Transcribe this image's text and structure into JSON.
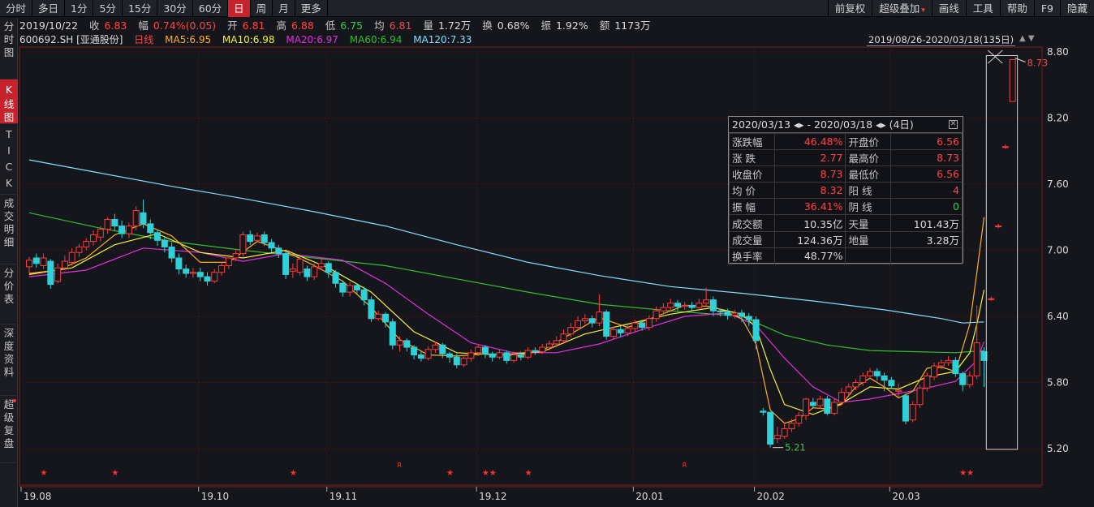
{
  "top_bar": {
    "period_tabs": [
      "分时",
      "多日",
      "1分",
      "5分",
      "15分",
      "30分",
      "60分",
      "日",
      "周",
      "月",
      "更多"
    ],
    "active_period": "日",
    "tool_tabs": [
      "前复权",
      "超级叠加",
      "画线",
      "工具",
      "帮助",
      "F9",
      "隐藏"
    ]
  },
  "side_tabs": [
    {
      "label": "分时图",
      "active": false
    },
    {
      "label": "K线图",
      "active": true
    },
    {
      "label": "TICK",
      "active": false
    },
    {
      "label": "成交明细",
      "active": false
    },
    {
      "label": "分价表",
      "active": false
    },
    {
      "label": "深度资料",
      "active": false
    },
    {
      "label": "超级复盘",
      "active": false,
      "dot": true
    }
  ],
  "quote": {
    "date": "2019/10/22",
    "close_label": "收",
    "close": "6.83",
    "change_label": "幅",
    "change": "0.74%(0.05)",
    "open_label": "开",
    "open": "6.81",
    "high_label": "高",
    "high": "6.88",
    "low_label": "低",
    "low": "6.75",
    "avg_label": "均",
    "avg": "6.81",
    "volume_label": "量",
    "volume": "1.72万",
    "turnover_label": "换",
    "turnover": "0.68%",
    "amplitude_label": "振",
    "amplitude": "1.92%",
    "amount_label": "额",
    "amount": "1173万"
  },
  "legend": {
    "code": "600692.SH [亚通股份]",
    "kline": "日线",
    "ma5": "MA5:6.95",
    "ma10": "MA10:6.98",
    "ma20": "MA20:6.97",
    "ma60": "MA60:6.94",
    "ma120": "MA120:7.33"
  },
  "range_label": "2019/08/26-2020/03/18(135日)",
  "colors": {
    "up": "#ff3b3b",
    "down": "#2fd1d8",
    "ma5": "#ffb020",
    "ma10": "#f5f23a",
    "ma20": "#e030e0",
    "ma60": "#2fbf2f",
    "ma120": "#7fe0ff",
    "grid": "#5a1a1a",
    "background": "#15161b"
  },
  "info_box": {
    "date_range": "2020/03/13 ◂▸ - 2020/03/18 ◂▸ (4日)",
    "rows": [
      {
        "k1": "涨跌幅",
        "v1": "46.48%",
        "c1": "red",
        "k2": "开盘价",
        "v2": "6.56",
        "c2": "red"
      },
      {
        "k1": "涨  跌",
        "v1": "2.77",
        "c1": "red",
        "k2": "最高价",
        "v2": "8.73",
        "c2": "red"
      },
      {
        "k1": "收盘价",
        "v1": "8.73",
        "c1": "red",
        "k2": "最低价",
        "v2": "6.56",
        "c2": "red"
      },
      {
        "k1": "均  价",
        "v1": "8.32",
        "c1": "red",
        "k2": "阳  线",
        "v2": "4",
        "c2": "red"
      },
      {
        "k1": "振  幅",
        "v1": "36.41%",
        "c1": "red",
        "k2": "阴  线",
        "v2": "0",
        "c2": "green"
      },
      {
        "k1": "成交额",
        "v1": "10.35亿",
        "c1": "white",
        "k2": "天量",
        "v2": "101.43万",
        "c2": "white"
      },
      {
        "k1": "成交量",
        "v1": "124.36万",
        "c1": "white",
        "k2": "地量",
        "v2": "3.28万",
        "c2": "white"
      },
      {
        "k1": "换手率",
        "v1": "48.77%",
        "c1": "white",
        "k2": "",
        "v2": "",
        "c2": "white"
      }
    ]
  },
  "chart_data": {
    "type": "candlestick",
    "y_ticks": [
      "8.80",
      "8.20",
      "7.60",
      "7.00",
      "6.40",
      "5.80",
      "5.20"
    ],
    "ylim": [
      5.15,
      8.85
    ],
    "x_ticks": [
      {
        "label": "19.08",
        "index": 0
      },
      {
        "label": "19.10",
        "index": 24
      },
      {
        "label": "19.11",
        "index": 42
      },
      {
        "label": "19.12",
        "index": 63
      },
      {
        "label": "20.01",
        "index": 85
      },
      {
        "label": "20.02",
        "index": 102
      },
      {
        "label": "20.03",
        "index": 121
      }
    ],
    "annotations": {
      "high_label": "8.73",
      "low_label": "5.21",
      "marker_star": "★",
      "marker_r": "R",
      "star_indices": [
        2,
        12,
        37,
        59,
        64,
        65,
        70,
        131,
        132
      ],
      "r_indices": [
        52,
        92
      ]
    },
    "candles": [
      [
        6.85,
        6.91,
        6.94,
        6.79
      ],
      [
        6.93,
        6.88,
        6.97,
        6.84
      ],
      [
        6.86,
        6.93,
        6.97,
        6.83
      ],
      [
        6.9,
        6.69,
        6.92,
        6.65
      ],
      [
        6.72,
        6.84,
        6.88,
        6.7
      ],
      [
        6.84,
        6.9,
        6.95,
        6.82
      ],
      [
        6.89,
        6.98,
        7.02,
        6.86
      ],
      [
        6.98,
        7.03,
        7.06,
        6.94
      ],
      [
        7.03,
        7.08,
        7.11,
        7.0
      ],
      [
        7.08,
        7.14,
        7.18,
        7.04
      ],
      [
        7.12,
        7.19,
        7.22,
        7.08
      ],
      [
        7.19,
        7.28,
        7.3,
        7.15
      ],
      [
        7.28,
        7.22,
        7.33,
        7.18
      ],
      [
        7.22,
        7.15,
        7.27,
        7.11
      ],
      [
        7.15,
        7.22,
        7.25,
        7.11
      ],
      [
        7.22,
        7.36,
        7.4,
        7.18
      ],
      [
        7.34,
        7.24,
        7.46,
        7.2
      ],
      [
        7.24,
        7.16,
        7.28,
        7.1
      ],
      [
        7.16,
        7.09,
        7.19,
        7.04
      ],
      [
        7.09,
        7.03,
        7.12,
        6.98
      ],
      [
        7.03,
        6.93,
        7.07,
        6.89
      ],
      [
        6.93,
        6.83,
        6.97,
        6.78
      ],
      [
        6.83,
        6.79,
        6.87,
        6.75
      ],
      [
        6.79,
        6.8,
        6.84,
        6.75
      ],
      [
        6.8,
        6.76,
        6.84,
        6.72
      ],
      [
        6.76,
        6.72,
        6.8,
        6.68
      ],
      [
        6.72,
        6.8,
        6.83,
        6.7
      ],
      [
        6.8,
        6.86,
        6.89,
        6.77
      ],
      [
        6.86,
        6.93,
        6.96,
        6.83
      ],
      [
        6.93,
        6.97,
        7.0,
        6.9
      ],
      [
        6.97,
        7.14,
        7.17,
        6.94
      ],
      [
        7.14,
        7.08,
        7.18,
        7.05
      ],
      [
        7.09,
        7.13,
        7.16,
        7.07
      ],
      [
        7.14,
        7.07,
        7.17,
        7.04
      ],
      [
        7.07,
        7.02,
        7.1,
        6.98
      ],
      [
        7.02,
        6.97,
        7.05,
        6.93
      ],
      [
        6.97,
        6.78,
        7.0,
        6.74
      ],
      [
        6.81,
        6.83,
        6.88,
        6.75
      ],
      [
        6.8,
        6.92,
        6.95,
        6.77
      ],
      [
        6.83,
        6.76,
        6.86,
        6.72
      ],
      [
        6.76,
        6.85,
        6.88,
        6.73
      ],
      [
        6.85,
        6.88,
        6.93,
        6.82
      ],
      [
        6.88,
        6.8,
        6.9,
        6.75
      ],
      [
        6.8,
        6.7,
        6.82,
        6.66
      ],
      [
        6.7,
        6.62,
        6.72,
        6.58
      ],
      [
        6.62,
        6.68,
        6.71,
        6.58
      ],
      [
        6.68,
        6.64,
        6.7,
        6.6
      ],
      [
        6.64,
        6.55,
        6.67,
        6.5
      ],
      [
        6.55,
        6.38,
        6.58,
        6.35
      ],
      [
        6.38,
        6.42,
        6.45,
        6.36
      ],
      [
        6.42,
        6.35,
        6.44,
        6.3
      ],
      [
        6.35,
        6.14,
        6.38,
        6.1
      ],
      [
        6.14,
        6.18,
        6.22,
        6.08
      ],
      [
        6.18,
        6.12,
        6.2,
        6.08
      ],
      [
        6.12,
        6.05,
        6.14,
        6.01
      ],
      [
        6.05,
        6.02,
        6.08,
        5.99
      ],
      [
        6.02,
        6.1,
        6.13,
        6.0
      ],
      [
        6.1,
        6.14,
        6.17,
        6.07
      ],
      [
        6.14,
        6.06,
        6.16,
        6.02
      ],
      [
        6.06,
        6.03,
        6.08,
        5.98
      ],
      [
        6.03,
        5.96,
        6.06,
        5.93
      ],
      [
        5.96,
        6.02,
        6.05,
        5.94
      ],
      [
        6.02,
        6.07,
        6.1,
        5.99
      ],
      [
        6.07,
        6.12,
        6.15,
        6.04
      ],
      [
        6.12,
        6.06,
        6.14,
        6.02
      ],
      [
        6.06,
        6.03,
        6.08,
        5.99
      ],
      [
        6.03,
        6.07,
        6.1,
        6.01
      ],
      [
        6.07,
        6.0,
        6.09,
        5.97
      ],
      [
        6.0,
        6.05,
        6.08,
        5.98
      ],
      [
        6.05,
        6.03,
        6.08,
        6.0
      ],
      [
        6.03,
        6.09,
        6.12,
        6.01
      ],
      [
        6.09,
        6.08,
        6.12,
        6.05
      ],
      [
        6.08,
        6.12,
        6.15,
        6.06
      ],
      [
        6.12,
        6.15,
        6.18,
        6.09
      ],
      [
        6.15,
        6.18,
        6.22,
        6.12
      ],
      [
        6.18,
        6.24,
        6.28,
        6.15
      ],
      [
        6.24,
        6.3,
        6.34,
        6.21
      ],
      [
        6.3,
        6.36,
        6.4,
        6.27
      ],
      [
        6.36,
        6.38,
        6.42,
        6.33
      ],
      [
        6.38,
        6.34,
        6.41,
        6.3
      ],
      [
        6.34,
        6.44,
        6.6,
        6.31
      ],
      [
        6.44,
        6.22,
        6.46,
        6.19
      ],
      [
        6.22,
        6.28,
        6.31,
        6.19
      ],
      [
        6.28,
        6.25,
        6.31,
        6.21
      ],
      [
        6.25,
        6.29,
        6.32,
        6.22
      ],
      [
        6.29,
        6.34,
        6.37,
        6.26
      ],
      [
        6.34,
        6.3,
        6.37,
        6.27
      ],
      [
        6.3,
        6.38,
        6.41,
        6.27
      ],
      [
        6.38,
        6.45,
        6.49,
        6.35
      ],
      [
        6.45,
        6.48,
        6.52,
        6.42
      ],
      [
        6.48,
        6.52,
        6.56,
        6.45
      ],
      [
        6.52,
        6.49,
        6.55,
        6.45
      ],
      [
        6.49,
        6.5,
        6.53,
        6.46
      ],
      [
        6.5,
        6.48,
        6.53,
        6.45
      ],
      [
        6.48,
        6.52,
        6.56,
        6.45
      ],
      [
        6.52,
        6.55,
        6.66,
        6.49
      ],
      [
        6.55,
        6.45,
        6.58,
        6.4
      ],
      [
        6.45,
        6.44,
        6.47,
        6.4
      ],
      [
        6.44,
        6.41,
        6.47,
        6.37
      ],
      [
        6.41,
        6.43,
        6.46,
        6.38
      ],
      [
        6.43,
        6.4,
        6.46,
        6.35
      ],
      [
        6.4,
        6.37,
        6.43,
        6.31
      ],
      [
        6.37,
        6.18,
        6.4,
        6.1
      ],
      [
        5.54,
        5.53,
        5.57,
        5.5
      ],
      [
        5.53,
        5.24,
        5.53,
        5.21
      ],
      [
        5.29,
        5.32,
        5.4,
        5.25
      ],
      [
        5.31,
        5.38,
        5.43,
        5.29
      ],
      [
        5.38,
        5.43,
        5.47,
        5.35
      ],
      [
        5.43,
        5.5,
        5.53,
        5.4
      ],
      [
        5.5,
        5.65,
        5.66,
        5.46
      ],
      [
        5.62,
        5.59,
        5.66,
        5.56
      ],
      [
        5.59,
        5.65,
        5.68,
        5.56
      ],
      [
        5.65,
        5.52,
        5.68,
        5.5
      ],
      [
        5.52,
        5.62,
        5.65,
        5.5
      ],
      [
        5.62,
        5.71,
        5.75,
        5.6
      ],
      [
        5.71,
        5.76,
        5.79,
        5.68
      ],
      [
        5.76,
        5.8,
        5.83,
        5.73
      ],
      [
        5.8,
        5.86,
        5.89,
        5.77
      ],
      [
        5.86,
        5.9,
        5.93,
        5.83
      ],
      [
        5.9,
        5.86,
        5.93,
        5.82
      ],
      [
        5.86,
        5.82,
        5.89,
        5.72
      ],
      [
        5.82,
        5.77,
        5.85,
        5.74
      ],
      [
        5.72,
        5.73,
        5.79,
        5.66
      ],
      [
        5.68,
        5.45,
        5.7,
        5.42
      ],
      [
        5.46,
        5.6,
        5.63,
        5.44
      ],
      [
        5.6,
        5.75,
        5.78,
        5.57
      ],
      [
        5.75,
        5.86,
        5.89,
        5.72
      ],
      [
        5.85,
        5.95,
        5.98,
        5.82
      ],
      [
        5.95,
        5.98,
        6.01,
        5.92
      ],
      [
        5.98,
        6.0,
        6.04,
        5.95
      ],
      [
        6.0,
        5.88,
        6.03,
        5.85
      ],
      [
        5.88,
        5.78,
        5.9,
        5.72
      ],
      [
        5.78,
        5.86,
        5.9,
        5.75
      ],
      [
        5.86,
        6.16,
        6.5,
        5.83
      ],
      [
        6.08,
        6.0,
        6.12,
        5.76
      ],
      [
        6.56,
        6.56,
        6.58,
        6.54
      ],
      [
        7.22,
        7.22,
        7.24,
        7.2
      ],
      [
        7.94,
        7.94,
        7.96,
        7.92
      ],
      [
        8.35,
        8.73,
        8.73,
        8.35
      ]
    ],
    "ma5": [
      [
        0,
        6.79
      ],
      [
        4,
        6.82
      ],
      [
        8,
        6.93
      ],
      [
        12,
        7.14
      ],
      [
        16,
        7.24
      ],
      [
        20,
        7.13
      ],
      [
        24,
        6.89
      ],
      [
        28,
        6.89
      ],
      [
        32,
        7.08
      ],
      [
        36,
        6.99
      ],
      [
        40,
        6.86
      ],
      [
        44,
        6.72
      ],
      [
        48,
        6.48
      ],
      [
        52,
        6.19
      ],
      [
        56,
        6.05
      ],
      [
        60,
        6.04
      ],
      [
        64,
        6.06
      ],
      [
        68,
        6.04
      ],
      [
        72,
        6.09
      ],
      [
        76,
        6.24
      ],
      [
        80,
        6.39
      ],
      [
        84,
        6.3
      ],
      [
        88,
        6.4
      ],
      [
        92,
        6.5
      ],
      [
        96,
        6.49
      ],
      [
        100,
        6.38
      ],
      [
        102,
        6.15
      ],
      [
        104,
        5.55
      ],
      [
        106,
        5.43
      ],
      [
        108,
        5.47
      ],
      [
        110,
        5.57
      ],
      [
        112,
        5.56
      ],
      [
        114,
        5.6
      ],
      [
        116,
        5.76
      ],
      [
        118,
        5.84
      ],
      [
        120,
        5.76
      ],
      [
        122,
        5.66
      ],
      [
        124,
        5.72
      ],
      [
        126,
        5.93
      ],
      [
        128,
        5.94
      ],
      [
        130,
        5.9
      ],
      [
        132,
        6.33
      ],
      [
        133,
        6.8
      ],
      [
        134,
        7.3
      ]
    ],
    "ma10": [
      [
        0,
        6.78
      ],
      [
        6,
        6.84
      ],
      [
        12,
        7.05
      ],
      [
        18,
        7.15
      ],
      [
        24,
        6.98
      ],
      [
        30,
        6.93
      ],
      [
        36,
        7.0
      ],
      [
        42,
        6.84
      ],
      [
        48,
        6.62
      ],
      [
        54,
        6.26
      ],
      [
        60,
        6.07
      ],
      [
        66,
        6.05
      ],
      [
        72,
        6.08
      ],
      [
        78,
        6.24
      ],
      [
        84,
        6.33
      ],
      [
        90,
        6.42
      ],
      [
        96,
        6.48
      ],
      [
        100,
        6.42
      ],
      [
        102,
        6.3
      ],
      [
        104,
        5.92
      ],
      [
        106,
        5.6
      ],
      [
        110,
        5.51
      ],
      [
        114,
        5.61
      ],
      [
        118,
        5.76
      ],
      [
        122,
        5.74
      ],
      [
        126,
        5.85
      ],
      [
        130,
        5.9
      ],
      [
        132,
        6.07
      ],
      [
        133,
        6.33
      ],
      [
        134,
        6.64
      ]
    ],
    "ma20": [
      [
        0,
        6.76
      ],
      [
        8,
        6.82
      ],
      [
        16,
        7.02
      ],
      [
        24,
        6.98
      ],
      [
        30,
        6.9
      ],
      [
        36,
        6.97
      ],
      [
        44,
        6.91
      ],
      [
        50,
        6.7
      ],
      [
        56,
        6.42
      ],
      [
        62,
        6.16
      ],
      [
        68,
        6.07
      ],
      [
        74,
        6.07
      ],
      [
        80,
        6.15
      ],
      [
        86,
        6.28
      ],
      [
        92,
        6.4
      ],
      [
        98,
        6.43
      ],
      [
        102,
        6.32
      ],
      [
        106,
        6.02
      ],
      [
        110,
        5.76
      ],
      [
        114,
        5.62
      ],
      [
        118,
        5.65
      ],
      [
        122,
        5.7
      ],
      [
        126,
        5.75
      ],
      [
        130,
        5.81
      ],
      [
        133,
        6.0
      ],
      [
        134,
        6.17
      ]
    ],
    "ma60": [
      [
        0,
        7.34
      ],
      [
        10,
        7.2
      ],
      [
        20,
        7.08
      ],
      [
        30,
        7.0
      ],
      [
        40,
        6.93
      ],
      [
        50,
        6.86
      ],
      [
        60,
        6.74
      ],
      [
        70,
        6.62
      ],
      [
        80,
        6.51
      ],
      [
        90,
        6.45
      ],
      [
        100,
        6.4
      ],
      [
        106,
        6.23
      ],
      [
        112,
        6.14
      ],
      [
        118,
        6.09
      ],
      [
        124,
        6.08
      ],
      [
        130,
        6.07
      ],
      [
        134,
        6.09
      ]
    ],
    "ma120": [
      [
        0,
        7.82
      ],
      [
        10,
        7.7
      ],
      [
        20,
        7.58
      ],
      [
        30,
        7.47
      ],
      [
        40,
        7.35
      ],
      [
        50,
        7.22
      ],
      [
        60,
        7.05
      ],
      [
        70,
        6.89
      ],
      [
        80,
        6.77
      ],
      [
        90,
        6.67
      ],
      [
        100,
        6.61
      ],
      [
        110,
        6.54
      ],
      [
        120,
        6.46
      ],
      [
        128,
        6.38
      ],
      [
        131,
        6.34
      ],
      [
        134,
        6.35
      ]
    ]
  }
}
